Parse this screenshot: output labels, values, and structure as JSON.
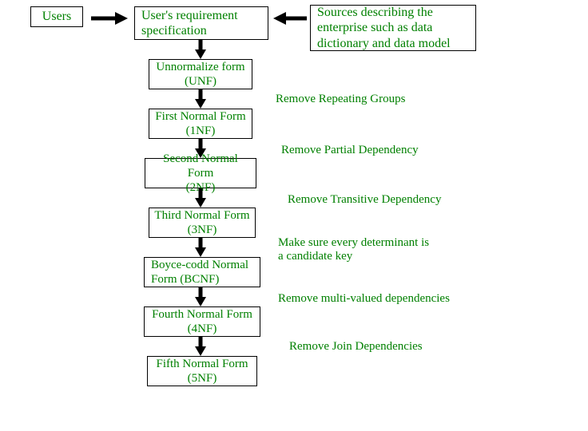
{
  "top": {
    "users": "Users",
    "requirement": "User's requirement specification",
    "sources": "Sources describing the enterprise such as data dictionary and data model"
  },
  "stages": {
    "unf_line1": "Unnormalize form",
    "unf_line2": "(UNF)",
    "nf1_line1": "First Normal Form",
    "nf1_line2": "(1NF)",
    "nf2_line1": "Second Normal Form",
    "nf2_line2": "(2NF)",
    "nf3_line1": "Third Normal Form",
    "nf3_line2": "(3NF)",
    "bcnf_line1": "Boyce-codd Normal",
    "bcnf_line2": "Form (BCNF)",
    "nf4_line1": "Fourth Normal Form",
    "nf4_line2": "(4NF)",
    "nf5_line1": "Fifth Normal Form",
    "nf5_line2": "(5NF)"
  },
  "actions": {
    "a1": "Remove Repeating Groups",
    "a2": "Remove Partial Dependency",
    "a3": "Remove Transitive Dependency",
    "a4_line1": "Make sure every determinant is",
    "a4_line2": "a candidate key",
    "a5": "Remove multi-valued dependencies",
    "a6": "Remove Join Dependencies"
  }
}
